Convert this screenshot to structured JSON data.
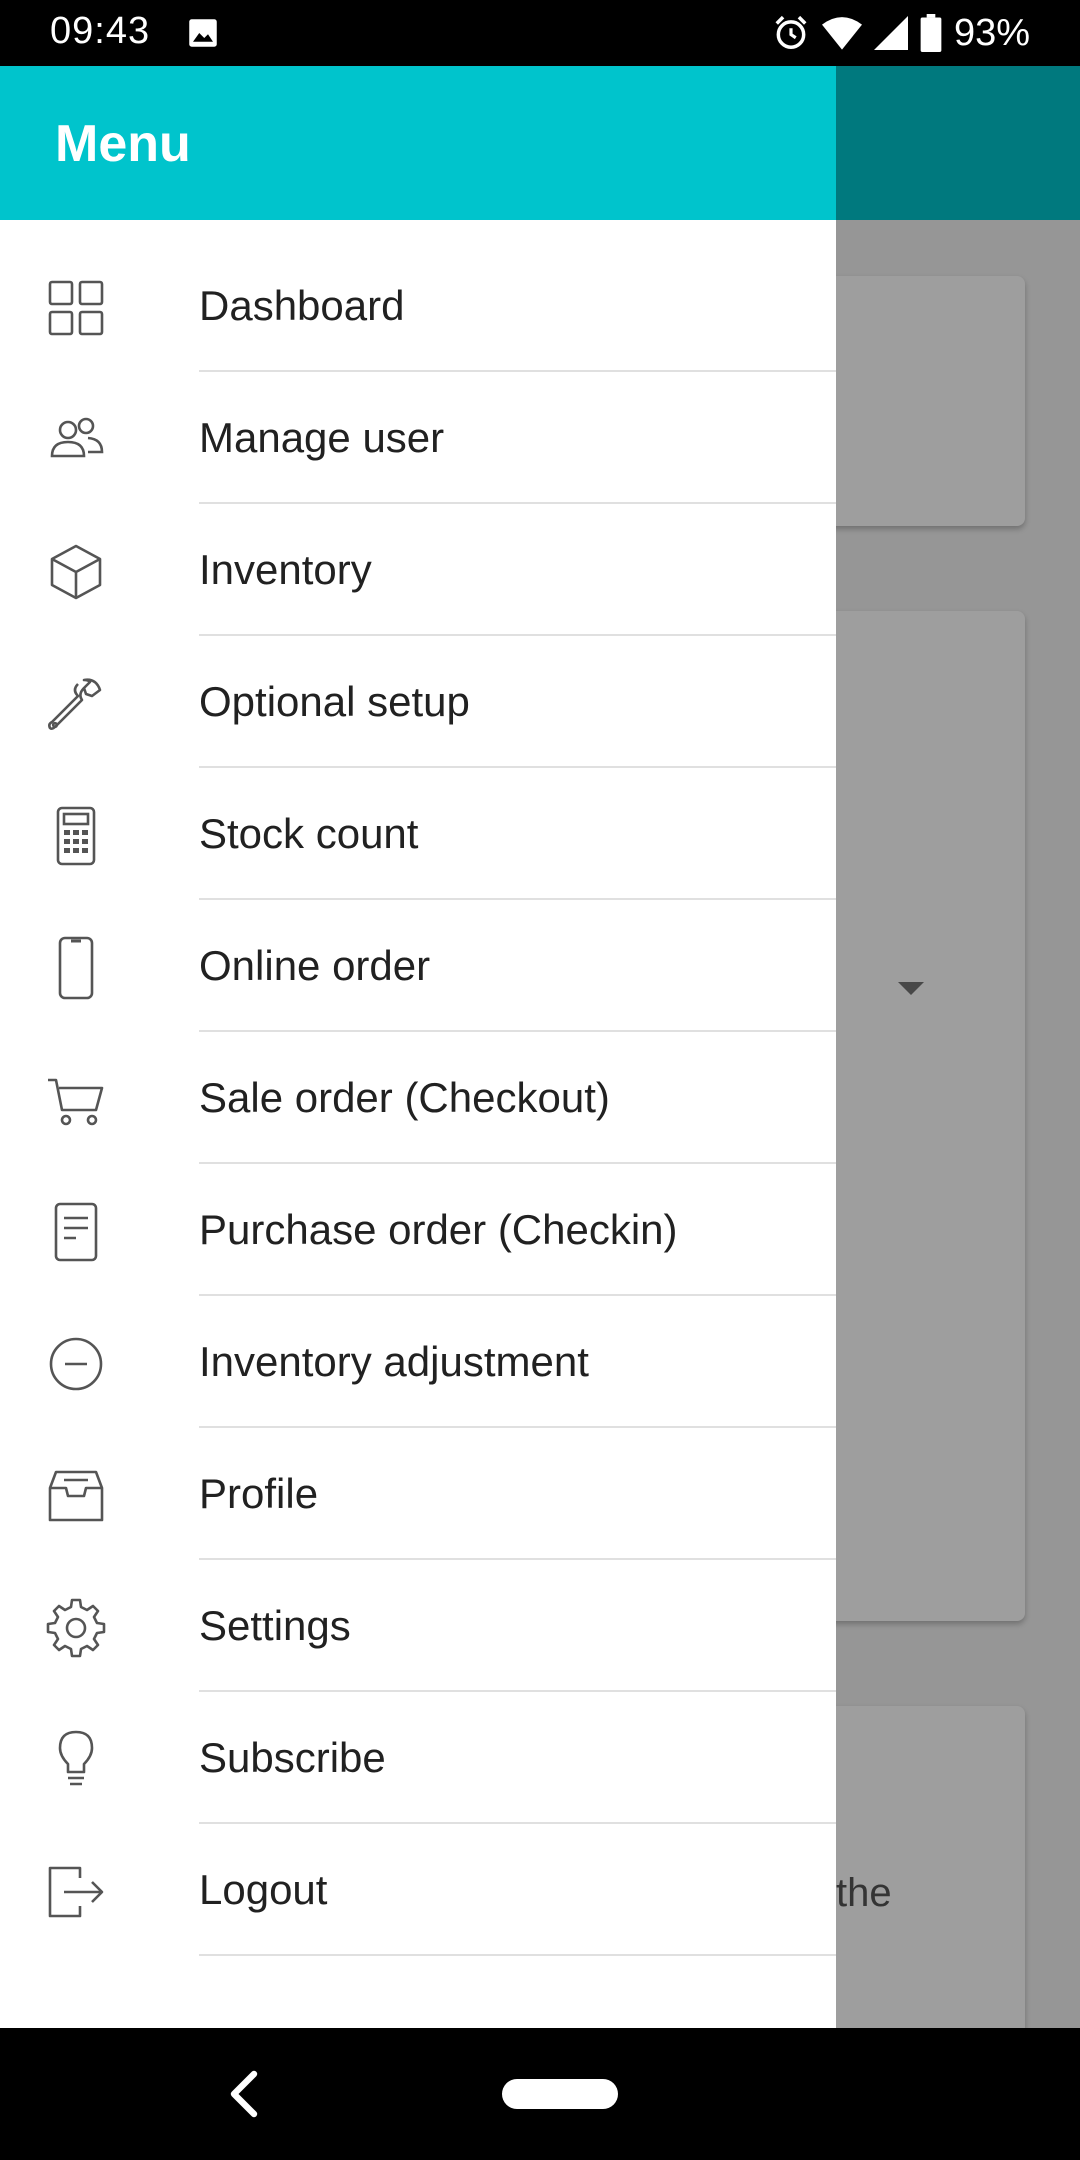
{
  "status_bar": {
    "time": "09:43",
    "battery": "93%",
    "icons": [
      "image-icon",
      "alarm-icon",
      "wifi-icon",
      "signal-icon",
      "battery-icon"
    ]
  },
  "drawer": {
    "title": "Menu",
    "header_color": "#00c4cc",
    "items": [
      {
        "label": "Dashboard",
        "icon": "dashboard-grid-icon"
      },
      {
        "label": "Manage user",
        "icon": "users-icon"
      },
      {
        "label": "Inventory",
        "icon": "box-icon"
      },
      {
        "label": "Optional setup",
        "icon": "wrench-icon"
      },
      {
        "label": "Stock count",
        "icon": "calculator-icon"
      },
      {
        "label": "Online order",
        "icon": "phone-icon"
      },
      {
        "label": "Sale order (Checkout)",
        "icon": "cart-icon"
      },
      {
        "label": "Purchase order (Checkin)",
        "icon": "document-icon"
      },
      {
        "label": "Inventory adjustment",
        "icon": "minus-circle-icon"
      },
      {
        "label": "Profile",
        "icon": "inbox-icon"
      },
      {
        "label": "Settings",
        "icon": "gear-icon"
      },
      {
        "label": "Subscribe",
        "icon": "lightbulb-icon"
      },
      {
        "label": "Logout",
        "icon": "logout-icon"
      }
    ]
  },
  "background": {
    "text_fragment": "the"
  },
  "nav_bar": {
    "icons": [
      "back-icon",
      "home-pill"
    ]
  }
}
